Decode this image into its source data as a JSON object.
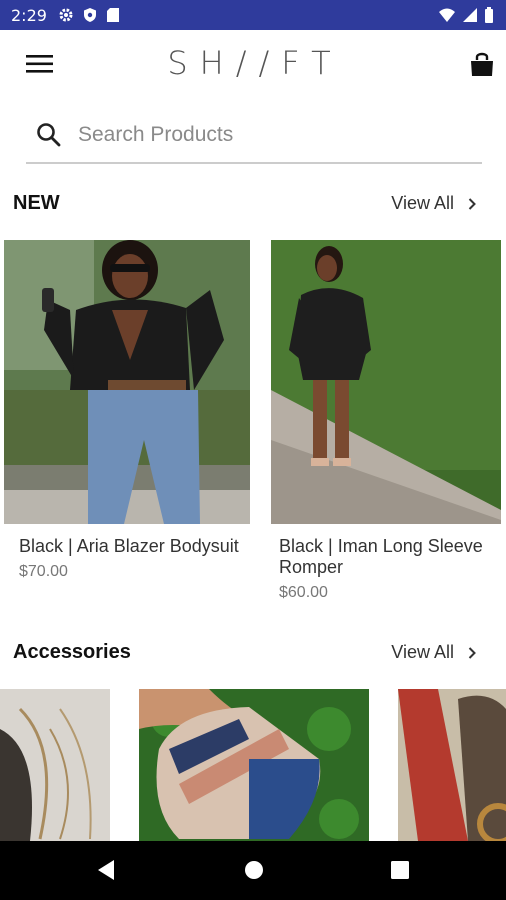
{
  "status_bar": {
    "time": "2:29",
    "left_icons": [
      "gear-icon",
      "shield-icon",
      "sd-card-icon"
    ],
    "right_icons": [
      "wifi-icon",
      "signal-icon",
      "battery-icon"
    ],
    "background": "#2f3b9c"
  },
  "app_bar": {
    "logo": "SH//FT",
    "menu_icon": "hamburger-menu-icon",
    "cart_icon": "shopping-bag-icon"
  },
  "search": {
    "placeholder": "Search Products",
    "value": ""
  },
  "sections": {
    "new": {
      "title": "NEW",
      "view_all": "View All",
      "products": [
        {
          "name": "Black | Aria Blazer Bodysuit",
          "price": "$70.00"
        },
        {
          "name": "Black | Iman Long Sleeve Romper",
          "price": "$60.00"
        }
      ]
    },
    "accessories": {
      "title": "Accessories",
      "view_all": "View All"
    }
  },
  "nav_bar": {
    "buttons": [
      "back-icon",
      "home-icon",
      "recents-icon"
    ]
  }
}
